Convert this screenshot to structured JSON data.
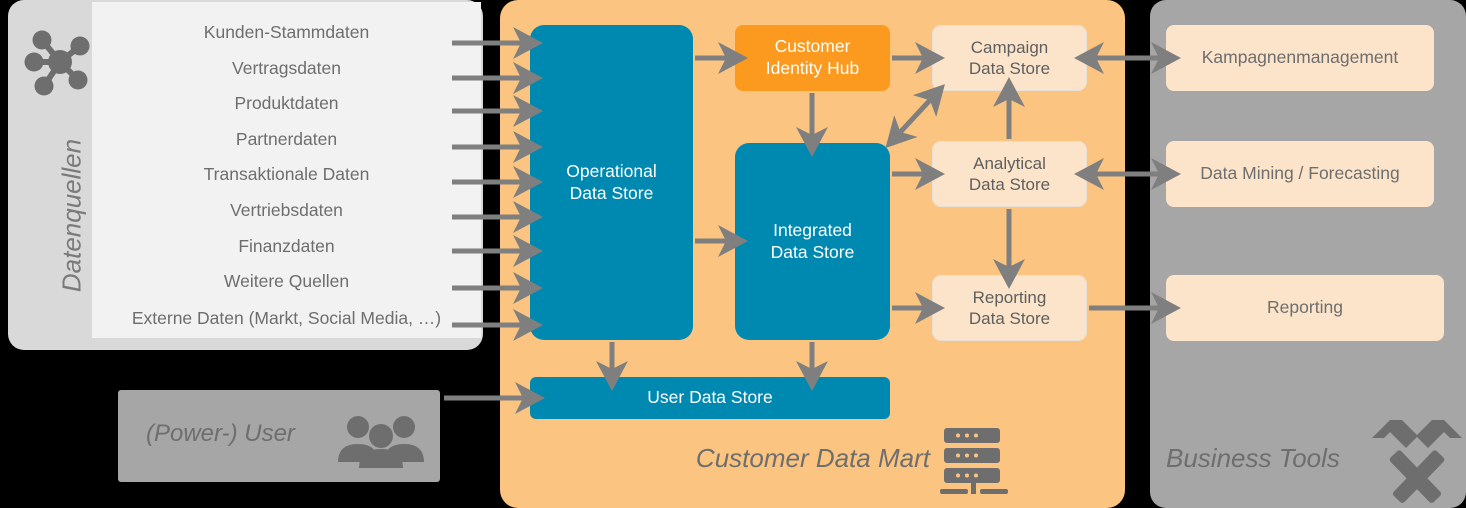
{
  "sources_panel": {
    "label": "Datenquellen",
    "icon": "network-hub-icon",
    "items": [
      "Kunden-Stammdaten",
      "Vertragsdaten",
      "Produktdaten",
      "Partnerdaten",
      "Transaktionale Daten",
      "Vertriebsdaten",
      "Finanzdaten",
      "Weitere Quellen",
      "Externe Daten (Markt,  Social Media, …)"
    ]
  },
  "user_panel": {
    "label": "(Power-) User",
    "icon": "users-group-icon"
  },
  "mart_panel": {
    "caption": "Customer Data Mart",
    "icon": "server-rack-icon",
    "boxes": {
      "operational": "Operational\nData Store",
      "operational_line1": "Operational",
      "operational_line2": "Data Store",
      "identity_hub_line1": "Customer",
      "identity_hub_line2": "Identity Hub",
      "integrated_line1": "Integrated",
      "integrated_line2": "Data Store",
      "user_store": "User Data Store",
      "campaign_line1": "Campaign",
      "campaign_line2": "Data Store",
      "analytical_line1": "Analytical",
      "analytical_line2": "Data Store",
      "reporting_line1": "Reporting",
      "reporting_line2": "Data Store"
    }
  },
  "tools_panel": {
    "caption": "Business Tools",
    "icon": "crossed-hammers-icon",
    "items": [
      "Kampagnenmanagement",
      "Data Mining / Forecasting",
      "Reporting"
    ]
  },
  "colors": {
    "blue_store": "#0089B0",
    "orange_hub": "#FB9A1E",
    "mart_background": "#FBC581",
    "cream_store": "#FCE4CA",
    "panel_gray": "#A6A6A6",
    "sources_gray": "#D9D9D9",
    "sources_inner": "#F2F2F2",
    "arrow_gray": "#7F7F7F",
    "text_gray": "#6E6E6E"
  }
}
